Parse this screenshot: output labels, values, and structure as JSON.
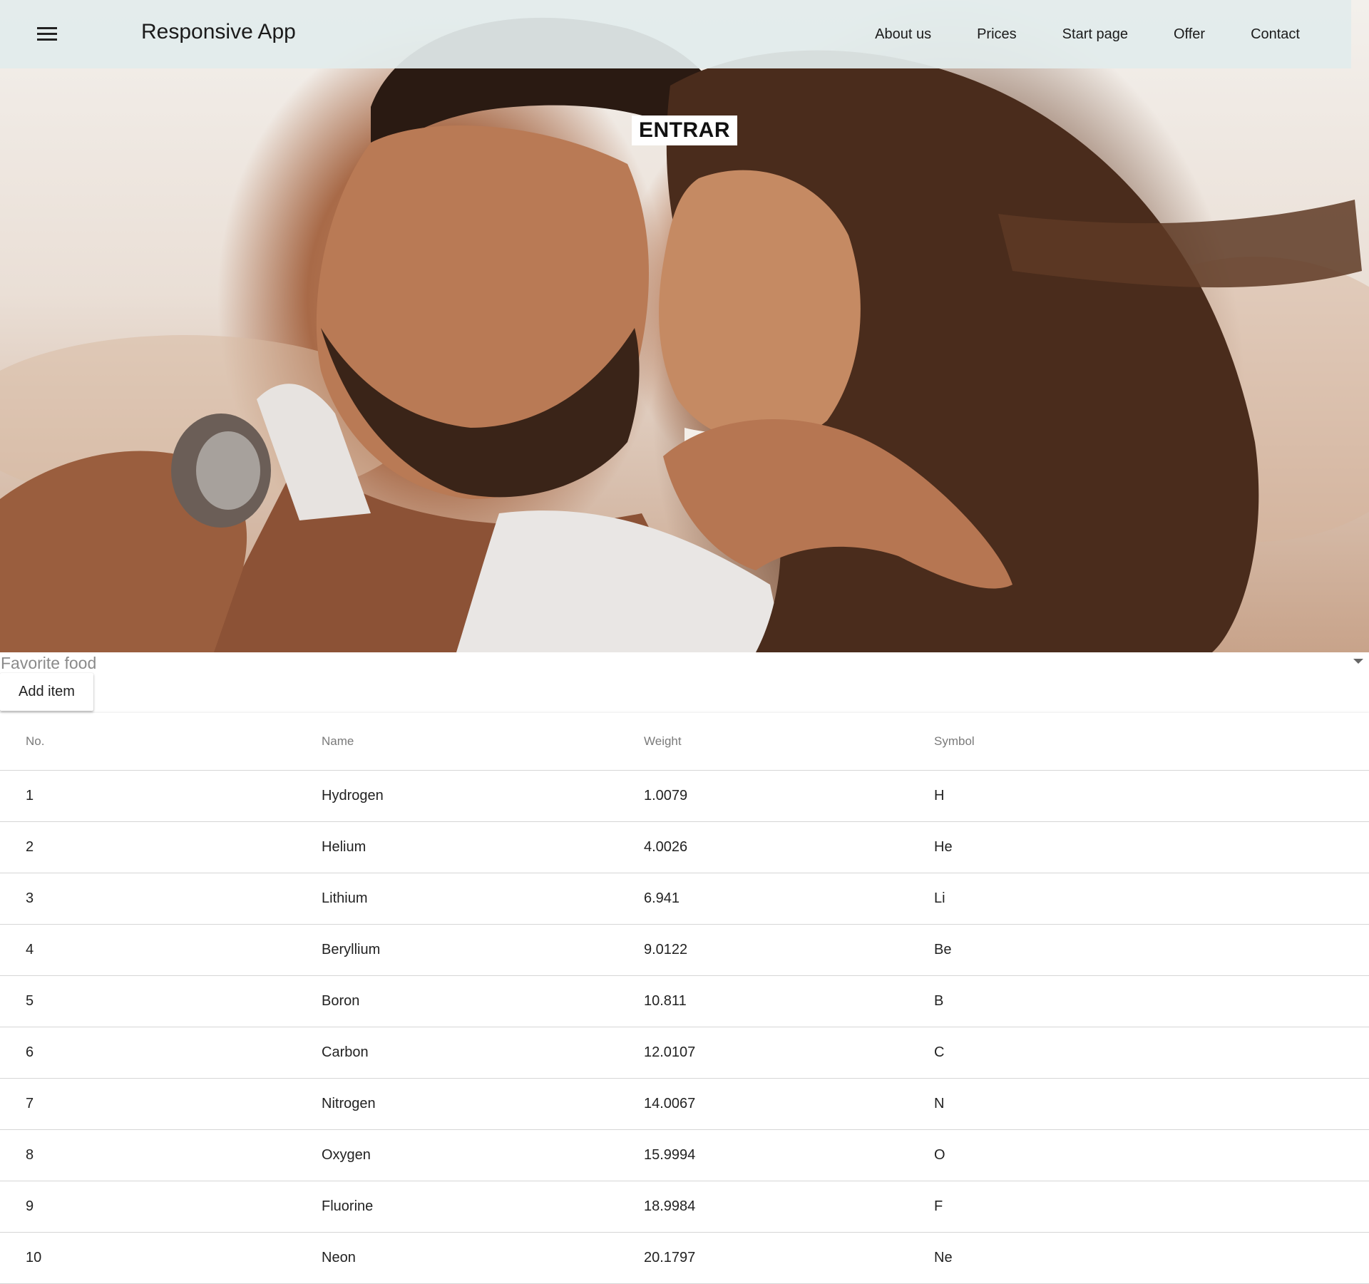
{
  "header": {
    "app_title": "Responsive App",
    "nav": [
      "About us",
      "Prices",
      "Start page",
      "Offer",
      "Contact"
    ]
  },
  "hero": {
    "image_icon": "hero-photo",
    "cta_label": "ENTRAR"
  },
  "form": {
    "select_placeholder": "Favorite food",
    "add_button_label": "Add item"
  },
  "table": {
    "columns": [
      "No.",
      "Name",
      "Weight",
      "Symbol"
    ],
    "rows": [
      [
        "1",
        "Hydrogen",
        "1.0079",
        "H"
      ],
      [
        "2",
        "Helium",
        "4.0026",
        "He"
      ],
      [
        "3",
        "Lithium",
        "6.941",
        "Li"
      ],
      [
        "4",
        "Beryllium",
        "9.0122",
        "Be"
      ],
      [
        "5",
        "Boron",
        "10.811",
        "B"
      ],
      [
        "6",
        "Carbon",
        "12.0107",
        "C"
      ],
      [
        "7",
        "Nitrogen",
        "14.0067",
        "N"
      ],
      [
        "8",
        "Oxygen",
        "15.9994",
        "O"
      ],
      [
        "9",
        "Fluorine",
        "18.9984",
        "F"
      ],
      [
        "10",
        "Neon",
        "20.1797",
        "Ne"
      ]
    ]
  },
  "colors": {
    "topbar_bg": "#e2ecec",
    "divider": "#d6d6d6",
    "header_text": "#7a7a7a"
  }
}
